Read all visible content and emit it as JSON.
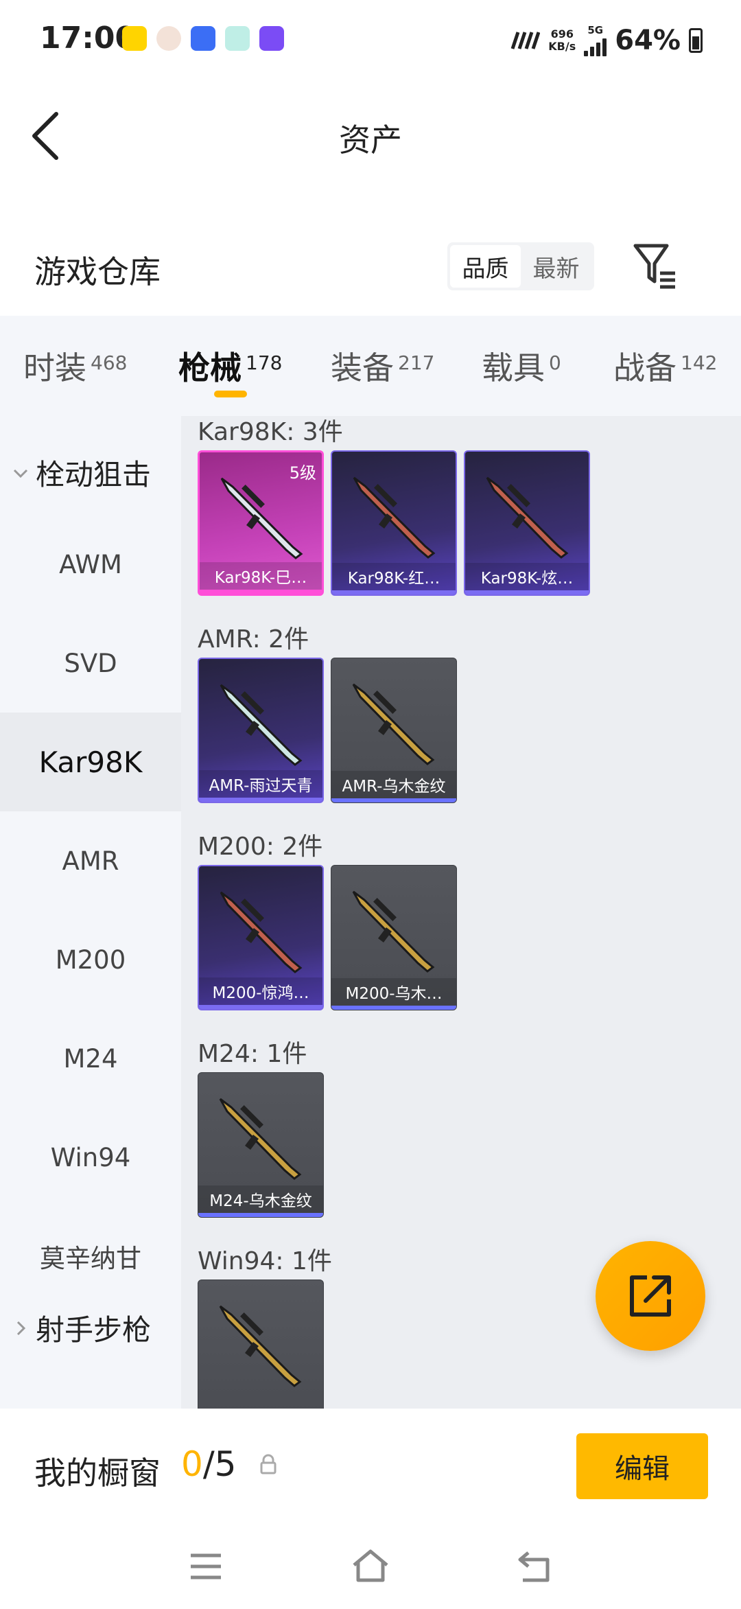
{
  "status_bar": {
    "time": "17:00",
    "net_speed_value": "696",
    "net_speed_unit": "KB/s",
    "network": "5G",
    "battery": "64%"
  },
  "header": {
    "title": "资产",
    "back_icon": "back-arrow-icon"
  },
  "section": {
    "title": "游戏仓库",
    "sort_options": [
      "品质",
      "最新"
    ],
    "sort_active": "品质",
    "filter_icon": "filter-icon"
  },
  "tabs": [
    {
      "label": "时装",
      "count": "468"
    },
    {
      "label": "枪械",
      "count": "178",
      "active": true
    },
    {
      "label": "装备",
      "count": "217"
    },
    {
      "label": "载具",
      "count": "0"
    },
    {
      "label": "战备",
      "count": "142"
    }
  ],
  "sidebar": {
    "group_open": "栓动狙击",
    "items": [
      "AWM",
      "SVD",
      "Kar98K",
      "AMR",
      "M200",
      "M24",
      "Win94",
      "莫辛纳甘"
    ],
    "active_item": "Kar98K",
    "group_closed": "射手步枪"
  },
  "content": {
    "groups": [
      {
        "label": "Kar98K: 3件",
        "items": [
          {
            "name": "Kar98K-巳…",
            "rarity": "pink",
            "badge": "5级"
          },
          {
            "name": "Kar98K-红…",
            "rarity": "purple"
          },
          {
            "name": "Kar98K-炫…",
            "rarity": "purple"
          }
        ]
      },
      {
        "label": "AMR: 2件",
        "items": [
          {
            "name": "AMR-雨过天青",
            "rarity": "purple"
          },
          {
            "name": "AMR-乌木金纹",
            "rarity": "gray"
          }
        ]
      },
      {
        "label": "M200: 2件",
        "items": [
          {
            "name": "M200-惊鸿…",
            "rarity": "purple"
          },
          {
            "name": "M200-乌木…",
            "rarity": "gray"
          }
        ]
      },
      {
        "label": "M24: 1件",
        "items": [
          {
            "name": "M24-乌木金纹",
            "rarity": "gray"
          }
        ]
      },
      {
        "label": "Win94: 1件",
        "items": [
          {
            "name": "",
            "rarity": "gray"
          }
        ]
      }
    ]
  },
  "showcase": {
    "label": "我的橱窗",
    "current": "0",
    "separator_total": "/5",
    "edit_label": "编辑"
  },
  "colors": {
    "accent": "#ffb400",
    "purple_rarity": "#7b6cf2",
    "pink_rarity": "#ff4fd8"
  }
}
